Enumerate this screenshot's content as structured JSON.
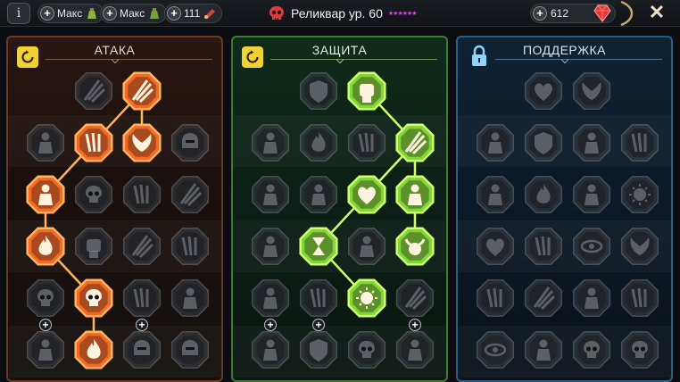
{
  "topbar": {
    "info_label": "i",
    "res1_text": "Макс",
    "res2_text": "Макс",
    "res3_text": "111",
    "title": "Реликвар ур. 60",
    "stars": "★★★★★★",
    "gems": "612",
    "close_label": "✕"
  },
  "panels": {
    "attack": {
      "title": "АТАКА",
      "color": "#f26a2a",
      "glow": "#ffb35a"
    },
    "defense": {
      "title": "ЗАЩИТА",
      "color": "#7fd63a",
      "glow": "#d0ff6a"
    },
    "support": {
      "title": "ПОДДЕРЖКА",
      "color": "#3c7da8"
    }
  },
  "icons": {
    "info": "info-icon",
    "plus": "plus-icon",
    "potion": "potion-icon",
    "scroll": "scroll-icon",
    "skull": "skull-icon",
    "gem": "ruby-icon",
    "reset": "refresh-icon",
    "lock": "padlock-icon",
    "close": "close-icon"
  },
  "plus_label": "+"
}
